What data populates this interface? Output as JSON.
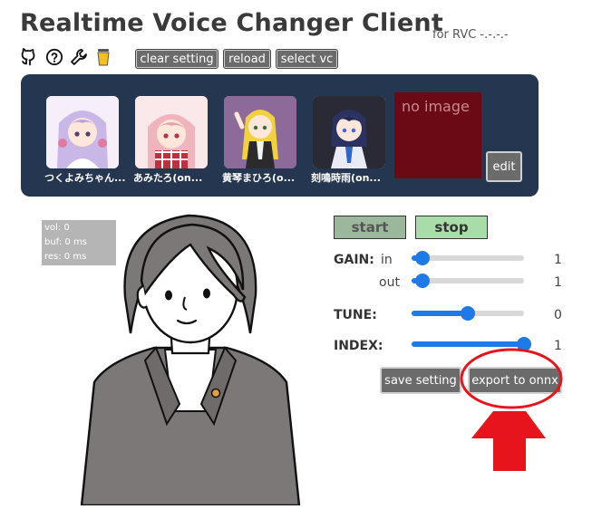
{
  "header": {
    "title": "Realtime Voice Changer Client",
    "subtitle": "for RVC -.-.-.-",
    "icons": [
      "github-icon",
      "help-icon",
      "wrench-icon",
      "coffee-icon"
    ],
    "buttons": {
      "clear": "clear setting",
      "reload": "reload",
      "select_vc": "select vc"
    }
  },
  "models": [
    {
      "name": "つくよみちゃん...",
      "hair": "#c9b7e8",
      "bg": "#f6eef8"
    },
    {
      "name": "あみたろ(on...",
      "hair": "#f0b5bc",
      "bg": "#fbe8ea"
    },
    {
      "name": "黄琴まひろ(o...",
      "hair": "#f2d23c",
      "bg": "#8c6a9a"
    },
    {
      "name": "刻鳴時雨(on...",
      "hair": "#2b3160",
      "bg": "#2a2a36"
    }
  ],
  "empty_slot": {
    "text": "no image",
    "edit": "edit"
  },
  "stats": {
    "vol": "vol: 0",
    "buf": "buf: 0 ms",
    "res": "res: 0 ms"
  },
  "controls": {
    "start": "start",
    "stop": "stop",
    "gain": {
      "label": "GAIN:",
      "in_label": "in",
      "out_label": "out",
      "in_value": "1",
      "out_value": "1",
      "in_level": 0.1,
      "out_level": 0.1
    },
    "tune": {
      "label": "TUNE:",
      "value": "0",
      "level": 0.5
    },
    "index": {
      "label": "INDEX:",
      "value": "1",
      "level": 1.0
    },
    "save": "save setting",
    "export": "export to onnx"
  },
  "colors": {
    "panel": "#253651",
    "slider": "#1e7ae6",
    "start": "#9cb89c",
    "stop": "#a8dca8",
    "highlight": "#e8141c"
  }
}
